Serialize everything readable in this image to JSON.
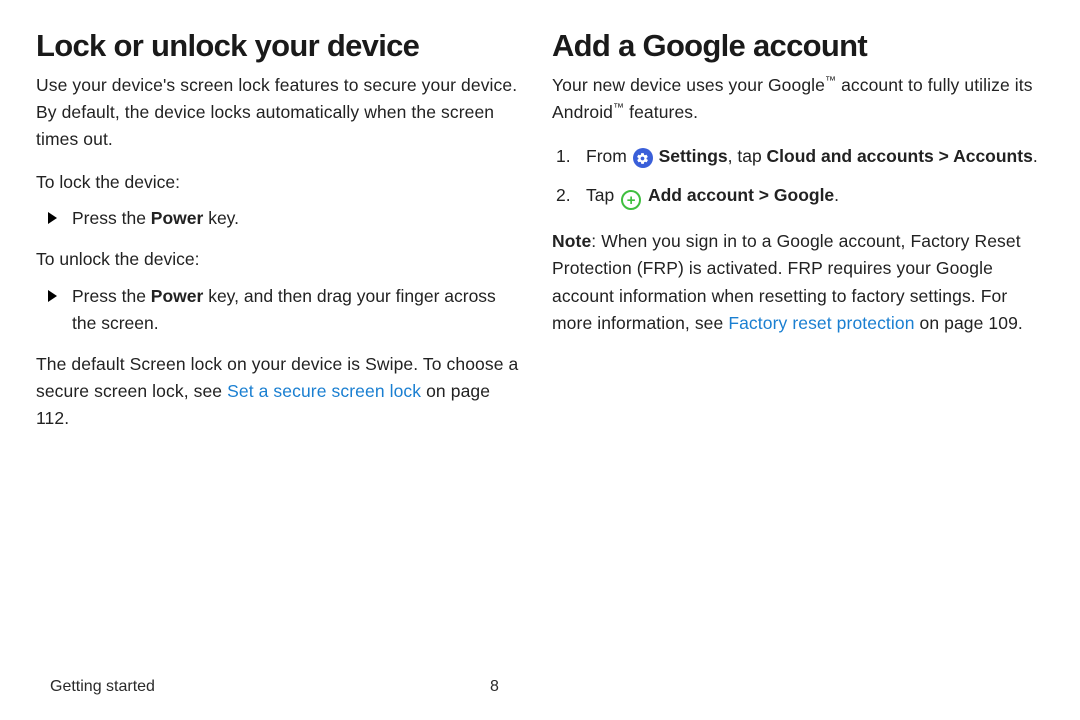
{
  "left": {
    "heading": "Lock or unlock your device",
    "intro": "Use your device's screen lock features to secure your device. By default, the device locks automatically when the screen times out.",
    "lock_lead": "To lock the device:",
    "lock_item_pre": "Press the ",
    "lock_item_bold": "Power",
    "lock_item_post": " key.",
    "unlock_lead": "To unlock the device:",
    "unlock_item_pre": "Press the ",
    "unlock_item_bold": "Power",
    "unlock_item_post": " key, and then drag your finger across the screen.",
    "default_pre": "The default Screen lock on your device is Swipe. To choose a secure screen lock, see ",
    "default_link": "Set a secure screen lock",
    "default_post": " on page 112."
  },
  "right": {
    "heading": "Add a Google account",
    "intro_pre": "Your new device uses your Google",
    "intro_mid": " account to fully utilize its Android",
    "intro_post": " features.",
    "step1_num": "1.",
    "step1_pre": "From ",
    "step1_b1": "Settings",
    "step1_mid": ", tap ",
    "step1_b2": "Cloud and accounts",
    "step1_caret": " > ",
    "step1_b3": "Accounts",
    "step1_post": ".",
    "step2_num": "2.",
    "step2_pre": "Tap ",
    "step2_b1": "Add account",
    "step2_caret": " > ",
    "step2_b2": "Google",
    "step2_post": ".",
    "note_b": "Note",
    "note_1": ": When you sign in to a Google account, Factory Reset Protection (FRP) is activated. FRP requires your Google account information when resetting to factory settings. For more information, see ",
    "note_link": "Factory reset protection",
    "note_2": " on page 109."
  },
  "footer": {
    "section": "Getting started",
    "page": "8"
  },
  "tm": "™"
}
